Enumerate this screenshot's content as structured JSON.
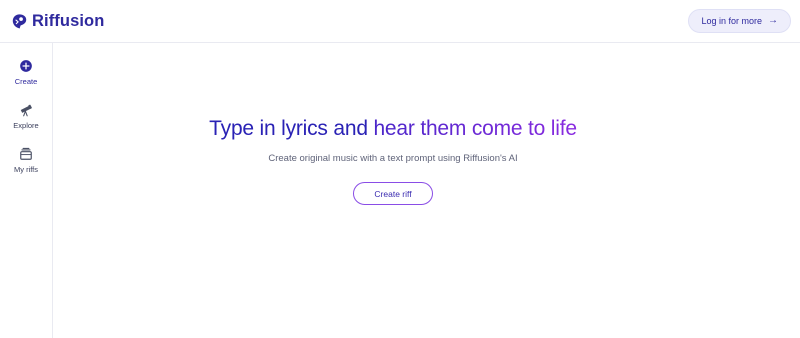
{
  "brand": {
    "name": "Riffusion",
    "logo_icon": "riffusion-logo-icon"
  },
  "header": {
    "login_label": "Log in for more",
    "login_icon": "arrow-right-icon"
  },
  "sidebar": {
    "items": [
      {
        "label": "Create",
        "icon": "plus-circle-icon",
        "active": true
      },
      {
        "label": "Explore",
        "icon": "telescope-icon",
        "active": false
      },
      {
        "label": "My riffs",
        "icon": "stacked-boxes-icon",
        "active": false
      }
    ]
  },
  "hero": {
    "title_part1": "Type in lyrics and ",
    "title_part2": "hear them come to life",
    "subtitle": "Create original music with a text prompt using Riffusion's AI",
    "cta_label": "Create riff"
  },
  "colors": {
    "brand": "#2f2a9e",
    "title_start": "#2a22b5",
    "title_gradient_end": "#8a2be0",
    "cta_border": "#8a4de6",
    "login_bg": "#eeeefb"
  }
}
